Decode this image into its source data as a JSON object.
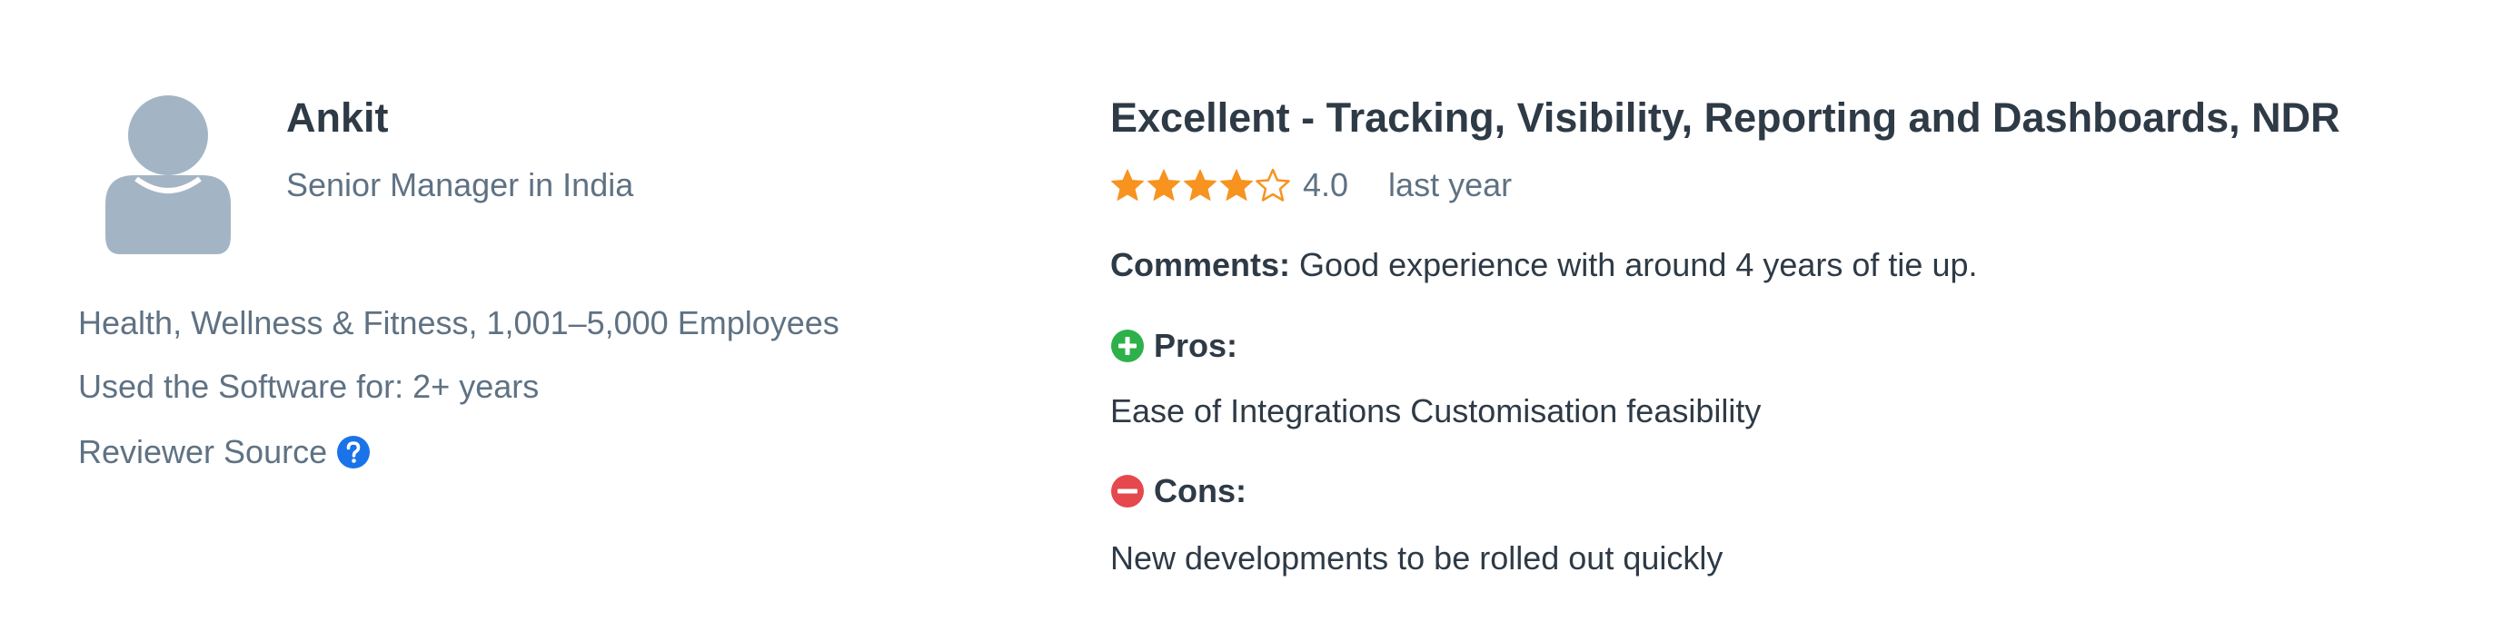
{
  "reviewer": {
    "name": "Ankit",
    "title": "Senior Manager in India",
    "industry": "Health, Wellness & Fitness, 1,001–5,000 Employees",
    "used_software": "Used the Software for: 2+ years",
    "source_label": "Reviewer Source"
  },
  "review": {
    "title": "Excellent - Tracking, Visibility, Reporting and Dashboards, NDR",
    "rating": 4.0,
    "rating_text": "4.0",
    "date": "last year",
    "comments_label": "Comments:",
    "comments_text": "Good experience with around 4 years of tie up.",
    "pros_label": "Pros:",
    "pros_text": "Ease of Integrations Customisation feasibility",
    "cons_label": "Cons:",
    "cons_text": "New developments to be rolled out quickly"
  },
  "icons": {
    "avatar": "user-avatar-icon",
    "help": "question-circle-icon",
    "star": "star-icon",
    "pros": "plus-circle-icon",
    "cons": "minus-circle-icon"
  },
  "colors": {
    "star": "#f7931e",
    "help": "#1a73e8",
    "pros": "#2db14b",
    "cons": "#e5484d",
    "avatar": "#a3b5c4"
  }
}
